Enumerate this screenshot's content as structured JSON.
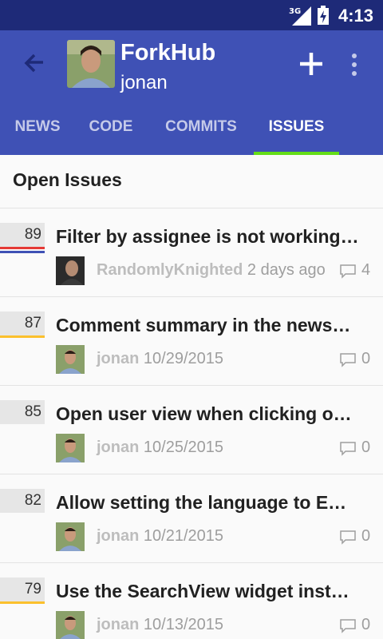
{
  "status_bar": {
    "network": "3G",
    "time": "4:13"
  },
  "app_bar": {
    "title": "ForkHub",
    "subtitle": "jonan",
    "back_icon": "arrow-back-icon",
    "add_icon": "plus-icon",
    "more_icon": "more-vert-icon"
  },
  "tabs": [
    {
      "label": "NEWS"
    },
    {
      "label": "CODE"
    },
    {
      "label": "COMMITS"
    },
    {
      "label": "ISSUES",
      "active": true
    }
  ],
  "section_title": "Open Issues",
  "issues": [
    {
      "number": "89",
      "title": "Filter by assignee is not working…",
      "user": "RandomlyKnighted",
      "date": "2 days ago",
      "comments": "4",
      "label_colors": [
        "#e53935",
        "#3f51b5"
      ]
    },
    {
      "number": "87",
      "title": "Comment summary in the news…",
      "user": "jonan",
      "date": "10/29/2015",
      "comments": "0",
      "label_colors": [
        "#fbc02d"
      ]
    },
    {
      "number": "85",
      "title": "Open user view when clicking o…",
      "user": "jonan",
      "date": "10/25/2015",
      "comments": "0",
      "label_colors": []
    },
    {
      "number": "82",
      "title": "Allow setting the language to E…",
      "user": "jonan",
      "date": "10/21/2015",
      "comments": "0",
      "label_colors": []
    },
    {
      "number": "79",
      "title": "Use the SearchView widget inst…",
      "user": "jonan",
      "date": "10/13/2015",
      "comments": "0",
      "label_colors": [
        "#fbc02d"
      ]
    }
  ],
  "colors": {
    "primary": "#3f51b5",
    "primary_dark": "#1e2a78",
    "tab_indicator": "#64dd17"
  }
}
